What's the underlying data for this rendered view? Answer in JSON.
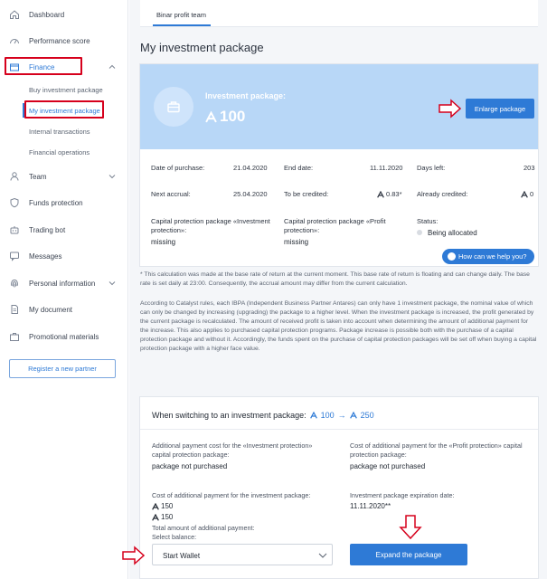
{
  "sidebar": {
    "items": [
      {
        "label": "Dashboard",
        "icon": "home-icon"
      },
      {
        "label": "Performance score",
        "icon": "gauge-icon"
      },
      {
        "label": "Finance",
        "icon": "wallet-icon"
      },
      {
        "label": "Team",
        "icon": "user-icon"
      },
      {
        "label": "Funds protection",
        "icon": "shield-icon"
      },
      {
        "label": "Trading bot",
        "icon": "bot-icon"
      },
      {
        "label": "Messages",
        "icon": "chat-icon"
      },
      {
        "label": "Personal information",
        "icon": "fingerprint-icon"
      },
      {
        "label": "My document",
        "icon": "document-icon"
      },
      {
        "label": "Promotional materials",
        "icon": "briefcase-icon"
      }
    ],
    "finance_sub": [
      {
        "label": "Buy investment package"
      },
      {
        "label": "My investment package"
      },
      {
        "label": "Internal transactions"
      },
      {
        "label": "Financial operations"
      }
    ],
    "register_label": "Register a new partner"
  },
  "header": {
    "tab_label": "Binar profit team",
    "page_title": "My investment package"
  },
  "package": {
    "label": "Investment package:",
    "value": "100",
    "enlarge_label": "Enlarge package"
  },
  "details": {
    "date_of_purchase_label": "Date of purchase:",
    "date_of_purchase": "21.04.2020",
    "end_date_label": "End date:",
    "end_date": "11.11.2020",
    "days_left_label": "Days left:",
    "days_left": "203",
    "next_accrual_label": "Next accrual:",
    "next_accrual": "25.04.2020",
    "to_be_credited_label": "To be credited:",
    "to_be_credited": "0.83*",
    "already_credited_label": "Already credited:",
    "already_credited": "0",
    "cap_inv_label": "Capital protection package «Investment protection»:",
    "cap_inv_value": "missing",
    "cap_profit_label": "Capital protection package «Profit protection»:",
    "cap_profit_value": "missing",
    "status_label": "Status:",
    "status_value": "Being allocated",
    "help_label": "How can we help you?"
  },
  "notes": {
    "note1": "* This calculation was made at the base rate of return at the current moment. This base rate of return is floating and can change daily. The base rate is set daily at 23:00. Consequently, the accrual amount may differ from the current calculation.",
    "note2": "According to Catalyst rules, each IBPA (Independent Business Partner Antares) can only have 1 investment package, the nominal value of which can only be changed by increasing (upgrading) the package to a higher level. When the investment package is increased, the profit generated by the current package is recalculated. The amount of received profit is taken into account when determining the amount of additional payment for the increase. This also applies to purchased capital protection programs. Package increase is possible both with the purchase of a capital protection package and without it. Accordingly, the funds spent on the purchase of capital protection packages will be set off when buying a capital protection package with a higher face value."
  },
  "switching": {
    "title": "When switching to an investment package:",
    "from": "100",
    "to": "250",
    "inv_cost_label": "Additional payment cost for the «Investment protection» capital protection package:",
    "inv_cost_value": "package not purchased",
    "profit_cost_label": "Cost of additional payment for the «Profit protection» capital protection package:",
    "profit_cost_value": "package not purchased",
    "pkg_cost_label": "Cost of additional payment for the investment package:",
    "pkg_cost_value": "150",
    "expiration_label": "Investment package expiration date:",
    "expiration_value": "11.11.2020**",
    "total_label": "Total amount of additional payment:",
    "total_value": "150",
    "balance_label": "Select balance:",
    "balance_value": "Start Wallet",
    "expand_label": "Expand the package"
  },
  "colors": {
    "accent": "#2e7ad6",
    "banner": "#b8d7f7",
    "annotation_red": "#d6001c"
  }
}
